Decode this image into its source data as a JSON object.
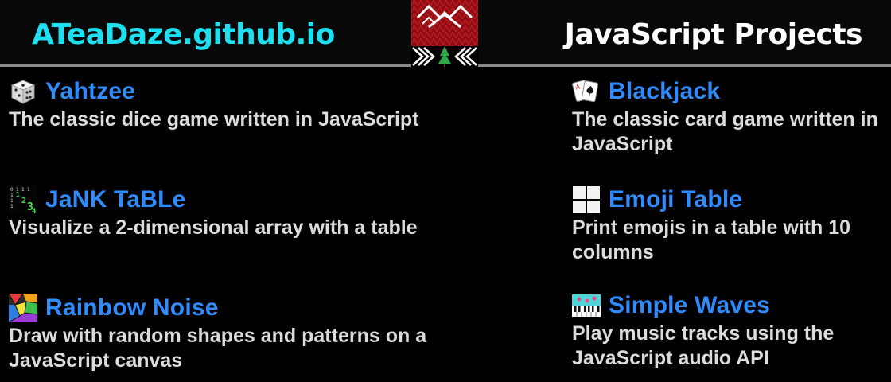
{
  "header": {
    "site_link": "ATeaDaze.github.io",
    "title": "JavaScript Projects",
    "logo_icon": "twin-peaks-logo-icon"
  },
  "projects": [
    {
      "title": "Yahtzee",
      "description": "The classic dice game written in JavaScript",
      "icon": "dice-icon"
    },
    {
      "title": "Blackjack",
      "description": "The classic card game written in JavaScript",
      "icon": "playing-cards-icon"
    },
    {
      "title": "JaNK TaBLe",
      "description": "Visualize a 2-dimensional array with a table",
      "icon": "matrix-table-icon"
    },
    {
      "title": "Emoji Table",
      "description": "Print emojis in a table with 10 columns",
      "icon": "grid-icon"
    },
    {
      "title": "Rainbow Noise",
      "description": "Draw with random shapes and patterns on a JavaScript canvas",
      "icon": "rainbow-shapes-icon"
    },
    {
      "title": "Simple Waves",
      "description": "Play music tracks using the JavaScript audio API",
      "icon": "piano-keys-icon"
    }
  ],
  "colors": {
    "site_link": "#1fe0f0",
    "project_title": "#2f8cff",
    "description": "#dcdcdc",
    "background": "#000000"
  }
}
